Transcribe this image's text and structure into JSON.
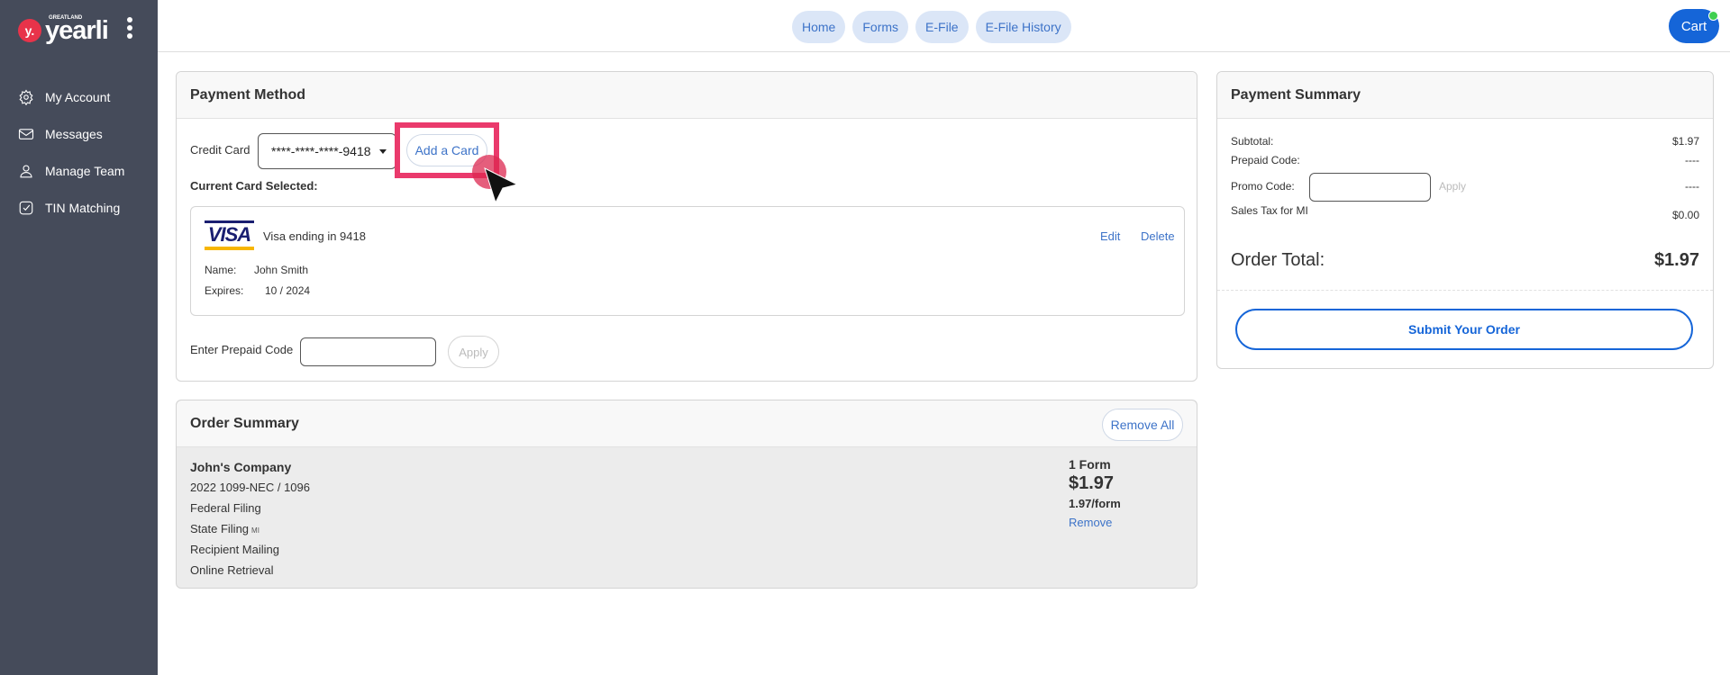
{
  "brand": {
    "small": "GREATLAND",
    "name": "yearli",
    "mark": "y."
  },
  "sidebar": {
    "items": [
      {
        "label": "My Account",
        "icon": "gear-icon"
      },
      {
        "label": "Messages",
        "icon": "envelope-icon"
      },
      {
        "label": "Manage Team",
        "icon": "user-icon"
      },
      {
        "label": "TIN Matching",
        "icon": "check-square-icon"
      }
    ]
  },
  "topnav": {
    "tabs": [
      {
        "label": "Home"
      },
      {
        "label": "Forms"
      },
      {
        "label": "E-File"
      },
      {
        "label": "E-File History"
      }
    ],
    "cart_label": "Cart"
  },
  "payment_method": {
    "title": "Payment Method",
    "credit_card_label": "Credit Card",
    "selected_card": "****-****-****-9418",
    "add_card_label": "Add a Card",
    "current_card_label": "Current Card Selected:",
    "card": {
      "brand": "VISA",
      "description": "Visa ending in 9418",
      "edit_label": "Edit",
      "delete_label": "Delete",
      "name_label": "Name:",
      "name": "John Smith",
      "expires_label": "Expires:",
      "expires": "10 / 2024"
    },
    "prepaid_label": "Enter Prepaid Code",
    "prepaid_value": "",
    "apply_label": "Apply"
  },
  "order_summary": {
    "title": "Order Summary",
    "remove_all_label": "Remove All",
    "company": "John's Company",
    "form_name": "2022 1099-NEC / 1096",
    "services": {
      "federal": "Federal Filing",
      "state": "State Filing",
      "state_code": "MI",
      "mailing": "Recipient Mailing",
      "retrieval": "Online Retrieval"
    },
    "form_count": "1 Form",
    "price": "$1.97",
    "per_form": "1.97/form",
    "remove_label": "Remove"
  },
  "payment_summary": {
    "title": "Payment Summary",
    "subtotal_label": "Subtotal:",
    "subtotal": "$1.97",
    "prepaid_label": "Prepaid Code:",
    "prepaid_value": "----",
    "promo_label": "Promo Code:",
    "promo_value": "",
    "promo_apply_label": "Apply",
    "promo_amount": "----",
    "tax_label": "Sales Tax for MI",
    "tax": "$0.00",
    "total_label": "Order Total:",
    "total": "$1.97",
    "submit_label": "Submit Your Order"
  },
  "colors": {
    "sidebar_bg": "#454b5a",
    "accent": "#1565d8",
    "link": "#3d73c8",
    "highlight": "#ea3a6c"
  }
}
